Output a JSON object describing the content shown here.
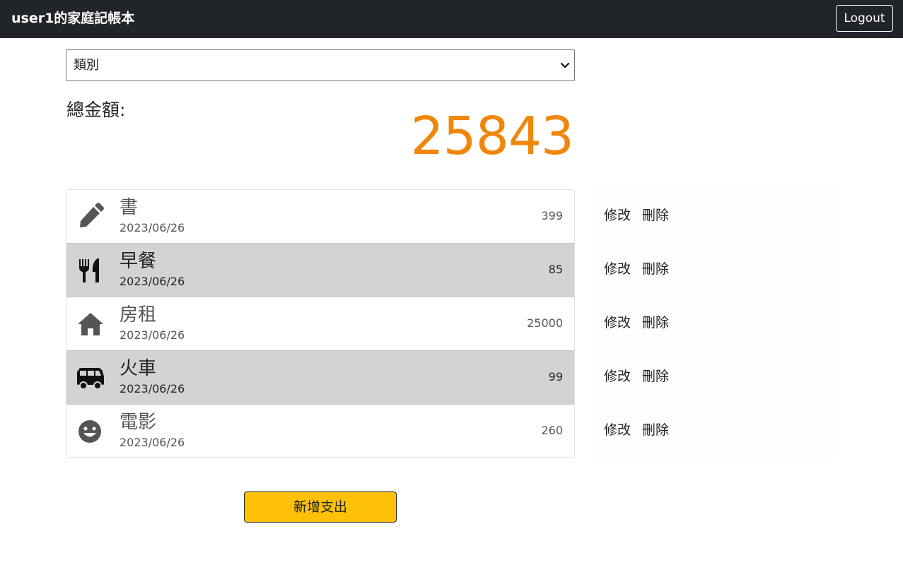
{
  "navbar": {
    "brand": "user1的家庭記帳本",
    "logout_label": "Logout"
  },
  "filter": {
    "selected": "類別"
  },
  "summary": {
    "label": "總金額:",
    "total": "25843",
    "total_color": "#f0860a"
  },
  "expenses": [
    {
      "title": "書",
      "date": "2023/06/26",
      "amount": "399",
      "icon": "pencil-icon",
      "edit_label": "修改",
      "delete_label": "刪除"
    },
    {
      "title": "早餐",
      "date": "2023/06/26",
      "amount": "85",
      "icon": "utensils-icon",
      "edit_label": "修改",
      "delete_label": "刪除"
    },
    {
      "title": "房租",
      "date": "2023/06/26",
      "amount": "25000",
      "icon": "home-icon",
      "edit_label": "修改",
      "delete_label": "刪除"
    },
    {
      "title": "火車",
      "date": "2023/06/26",
      "amount": "99",
      "icon": "van-icon",
      "edit_label": "修改",
      "delete_label": "刪除"
    },
    {
      "title": "電影",
      "date": "2023/06/26",
      "amount": "260",
      "icon": "smile-icon",
      "edit_label": "修改",
      "delete_label": "刪除"
    }
  ],
  "add_button_label": "新增支出",
  "colors": {
    "navbar": "#212529",
    "accent_button": "#ffc107",
    "row_highlight": "#d3d3d3"
  }
}
